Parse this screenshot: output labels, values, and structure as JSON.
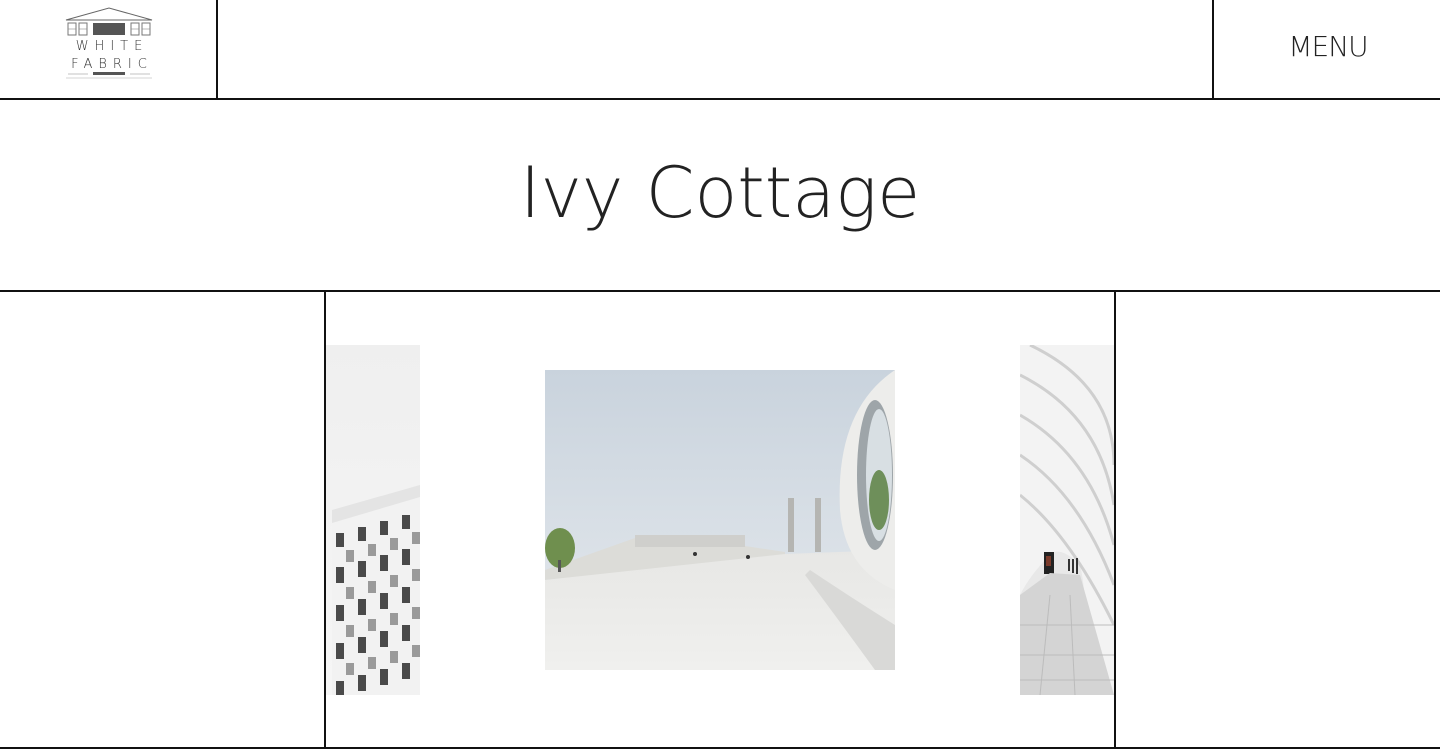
{
  "brand": {
    "line1": "WHITE",
    "line2": "FABRIC",
    "logo_icon": "house-roof-icon"
  },
  "nav": {
    "menu_label": "MENU"
  },
  "page": {
    "title": "Ivy Cottage"
  },
  "gallery": {
    "slides": [
      {
        "icon": "building-facade-photo"
      },
      {
        "icon": "plaza-architecture-photo"
      },
      {
        "icon": "white-tunnel-photo"
      }
    ]
  },
  "colors": {
    "border": "#111111",
    "background": "#ffffff",
    "text": "#222222"
  }
}
